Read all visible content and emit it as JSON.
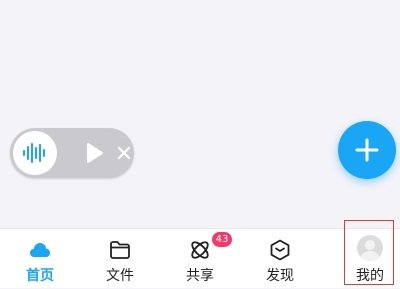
{
  "tabs": [
    {
      "label": "首页",
      "icon": "cloud-home-icon",
      "active": true
    },
    {
      "label": "文件",
      "icon": "folder-icon",
      "active": false
    },
    {
      "label": "共享",
      "icon": "share-atom-icon",
      "active": false,
      "badge": "43"
    },
    {
      "label": "发现",
      "icon": "discover-hexagon-icon",
      "active": false
    },
    {
      "label": "我的",
      "icon": "avatar-icon",
      "active": false
    }
  ],
  "player": {
    "icons": [
      "audio-wave-icon",
      "play-icon",
      "close-icon"
    ]
  },
  "fab": {
    "icon": "plus-icon"
  },
  "colors": {
    "accent": "#1aa6f4",
    "badge": "#f5386a",
    "highlight_box": "#e53935",
    "background": "#f3f3f8"
  }
}
